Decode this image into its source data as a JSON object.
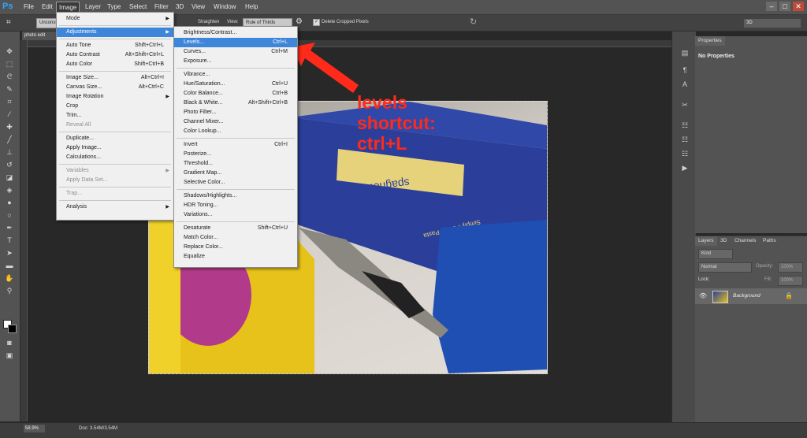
{
  "app": {
    "logo": "Ps"
  },
  "menubar": {
    "items": [
      "File",
      "Edit",
      "Image",
      "Layer",
      "Type",
      "Select",
      "Filter",
      "3D",
      "View",
      "Window",
      "Help"
    ],
    "window_controls": [
      "–",
      "□",
      "✕"
    ]
  },
  "options": {
    "preset": "Unconst",
    "straighten": "Straighten",
    "view_label": "View:",
    "view_value": "Rule of Thirds",
    "delete_cropped": "Delete Cropped Pixels",
    "workspace": "3D"
  },
  "document": {
    "tab": "photo edit",
    "zoom": "58.9%",
    "docsize": "Doc: 3.54M/3.54M"
  },
  "image_menu": [
    {
      "label": "Mode",
      "shortcut": "",
      "sub": true
    },
    {
      "sep": true
    },
    {
      "label": "Adjustments",
      "shortcut": "",
      "sub": true,
      "hl": true
    },
    {
      "sep": true
    },
    {
      "label": "Auto Tone",
      "shortcut": "Shift+Ctrl+L"
    },
    {
      "label": "Auto Contrast",
      "shortcut": "Alt+Shift+Ctrl+L"
    },
    {
      "label": "Auto Color",
      "shortcut": "Shift+Ctrl+B"
    },
    {
      "sep": true
    },
    {
      "label": "Image Size...",
      "shortcut": "Alt+Ctrl+I"
    },
    {
      "label": "Canvas Size...",
      "shortcut": "Alt+Ctrl+C"
    },
    {
      "label": "Image Rotation",
      "shortcut": "",
      "sub": true
    },
    {
      "label": "Crop",
      "shortcut": ""
    },
    {
      "label": "Trim...",
      "shortcut": ""
    },
    {
      "label": "Reveal All",
      "shortcut": "",
      "disabled": true
    },
    {
      "sep": true
    },
    {
      "label": "Duplicate...",
      "shortcut": ""
    },
    {
      "label": "Apply Image...",
      "shortcut": ""
    },
    {
      "label": "Calculations...",
      "shortcut": ""
    },
    {
      "sep": true
    },
    {
      "label": "Variables",
      "shortcut": "",
      "sub": true,
      "disabled": true
    },
    {
      "label": "Apply Data Set...",
      "shortcut": "",
      "disabled": true
    },
    {
      "sep": true
    },
    {
      "label": "Trap...",
      "shortcut": "",
      "disabled": true
    },
    {
      "sep": true
    },
    {
      "label": "Analysis",
      "shortcut": "",
      "sub": true
    }
  ],
  "adjustments_menu": [
    {
      "label": "Brightness/Contrast...",
      "shortcut": ""
    },
    {
      "label": "Levels...",
      "shortcut": "Ctrl+L",
      "hl": true
    },
    {
      "label": "Curves...",
      "shortcut": "Ctrl+M"
    },
    {
      "label": "Exposure...",
      "shortcut": ""
    },
    {
      "sep": true
    },
    {
      "label": "Vibrance...",
      "shortcut": ""
    },
    {
      "label": "Hue/Saturation...",
      "shortcut": "Ctrl+U"
    },
    {
      "label": "Color Balance...",
      "shortcut": "Ctrl+B"
    },
    {
      "label": "Black & White...",
      "shortcut": "Alt+Shift+Ctrl+B"
    },
    {
      "label": "Photo Filter...",
      "shortcut": ""
    },
    {
      "label": "Channel Mixer...",
      "shortcut": ""
    },
    {
      "label": "Color Lookup...",
      "shortcut": ""
    },
    {
      "sep": true
    },
    {
      "label": "Invert",
      "shortcut": "Ctrl+I"
    },
    {
      "label": "Posterize...",
      "shortcut": ""
    },
    {
      "label": "Threshold...",
      "shortcut": ""
    },
    {
      "label": "Gradient Map...",
      "shortcut": ""
    },
    {
      "label": "Selective Color...",
      "shortcut": ""
    },
    {
      "sep": true
    },
    {
      "label": "Shadows/Highlights...",
      "shortcut": ""
    },
    {
      "label": "HDR Toning...",
      "shortcut": ""
    },
    {
      "label": "Variations...",
      "shortcut": ""
    },
    {
      "sep": true
    },
    {
      "label": "Desaturate",
      "shortcut": "Shift+Ctrl+U"
    },
    {
      "label": "Match Color...",
      "shortcut": ""
    },
    {
      "label": "Replace Color...",
      "shortcut": ""
    },
    {
      "label": "Equalize",
      "shortcut": ""
    }
  ],
  "annotation": {
    "line1": "levels",
    "line2": "shortcut:",
    "line3": "ctrl+L",
    "color": "#ff2a1a"
  },
  "properties": {
    "tab": "Properties",
    "empty": "No Properties"
  },
  "layers": {
    "tabs": [
      "Layers",
      "3D",
      "Channels",
      "Paths"
    ],
    "filter": "Kind",
    "blend": "Normal",
    "opacity_label": "Opacity:",
    "opacity": "100%",
    "lock_label": "Lock:",
    "fill_label": "Fill:",
    "fill": "100%",
    "layer_name": "Background"
  },
  "photo": {
    "box_text_1": "spaghetti",
    "box_text_2": "Simply Perfect Pasta"
  }
}
